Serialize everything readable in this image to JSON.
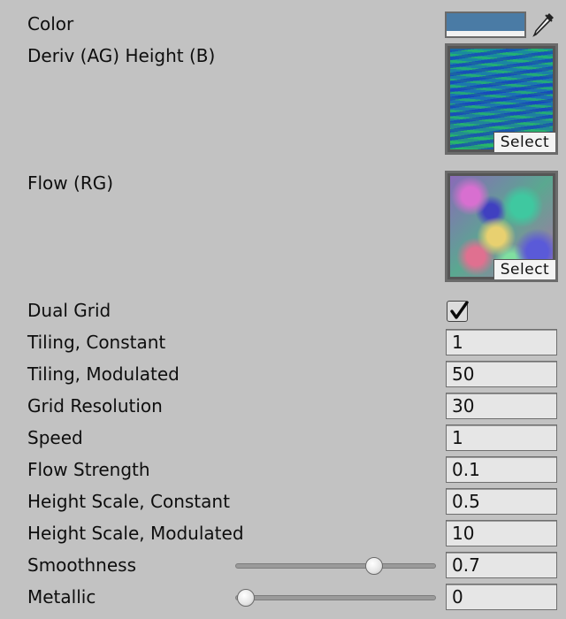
{
  "properties": {
    "color": {
      "label": "Color",
      "value": "#4a7ba5"
    },
    "deriv_height": {
      "label": "Deriv (AG) Height (B)",
      "select_label": "Select"
    },
    "flow": {
      "label": "Flow (RG)",
      "select_label": "Select"
    },
    "dual_grid": {
      "label": "Dual Grid",
      "checked": true
    },
    "tiling_constant": {
      "label": "Tiling, Constant",
      "value": "1"
    },
    "tiling_modulated": {
      "label": "Tiling, Modulated",
      "value": "50"
    },
    "grid_resolution": {
      "label": "Grid Resolution",
      "value": "30"
    },
    "speed": {
      "label": "Speed",
      "value": "1"
    },
    "flow_strength": {
      "label": "Flow Strength",
      "value": "0.1"
    },
    "height_scale_constant": {
      "label": "Height Scale, Constant",
      "value": "0.5"
    },
    "height_scale_modulated": {
      "label": "Height Scale, Modulated",
      "value": "10"
    },
    "smoothness": {
      "label": "Smoothness",
      "value": "0.7",
      "slider_fraction": 0.7
    },
    "metallic": {
      "label": "Metallic",
      "value": "0",
      "slider_fraction": 0
    }
  },
  "icons": {
    "eyedropper": "eyedropper-icon",
    "checkmark": "checkmark-icon"
  }
}
